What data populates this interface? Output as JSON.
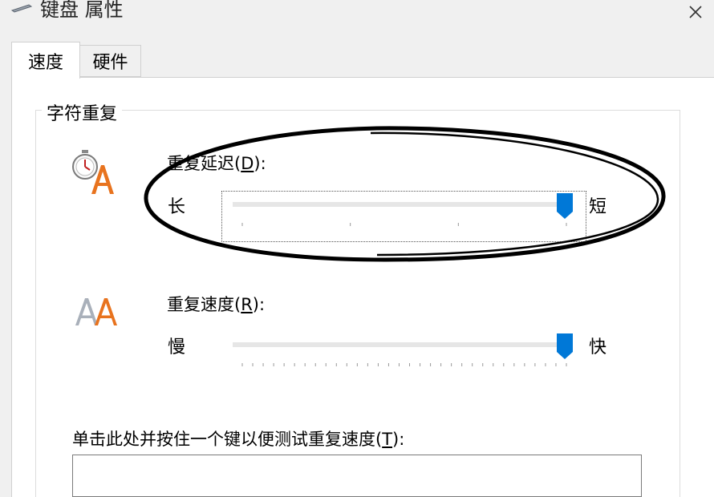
{
  "window": {
    "title": "键盘 属性"
  },
  "tabs": [
    {
      "label": "速度",
      "active": true
    },
    {
      "label": "硬件",
      "active": false
    }
  ],
  "group": {
    "legend": "字符重复",
    "delay": {
      "label": "重复延迟(",
      "hotkey": "D",
      "label_suffix": "):",
      "min_label": "长",
      "max_label": "短",
      "value_fraction": 1.0
    },
    "rate": {
      "label": "重复速度(",
      "hotkey": "R",
      "label_suffix": "):",
      "min_label": "慢",
      "max_label": "快",
      "value_fraction": 1.0
    }
  },
  "test": {
    "label": "单击此处并按住一个键以便测试重复速度(",
    "hotkey": "T",
    "label_suffix": "):",
    "value": ""
  },
  "icons": {
    "title": "keyboard-icon",
    "close": "close-icon",
    "delay": "stopwatch-letter-icon",
    "rate": "double-letter-icon"
  },
  "colors": {
    "accent": "#0078d7",
    "letter_orange": "#e8731e",
    "annotation": "#000000"
  }
}
